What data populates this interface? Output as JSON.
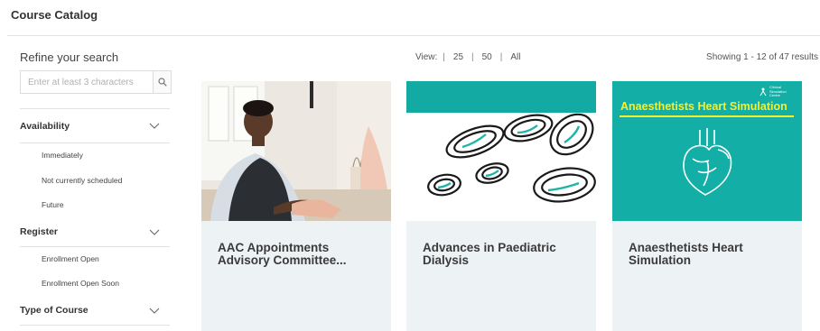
{
  "page": {
    "title": "Course Catalog"
  },
  "sidebar": {
    "heading": "Refine your search",
    "search_placeholder": "Enter at least 3 characters",
    "search_value": "",
    "facets": [
      {
        "title": "Availability",
        "options": [
          "Immediately",
          "Not currently scheduled",
          "Future"
        ]
      },
      {
        "title": "Register",
        "options": [
          "Enrollment Open",
          "Enrollment Open Soon"
        ]
      },
      {
        "title": "Type of Course",
        "options": []
      }
    ]
  },
  "toolbar": {
    "view_label": "View:",
    "view_options": [
      "25",
      "50",
      "All"
    ],
    "separator": "|",
    "results_text": "Showing 1 - 12 of 47 results"
  },
  "cards": [
    {
      "title_line1": "AAC Appointments",
      "title_line2": "Advisory Committee...",
      "image": "photo-handshake"
    },
    {
      "title_line1": "Advances in Paediatric",
      "title_line2": "Dialysis",
      "image": "dialysis-illustration"
    },
    {
      "title_line1": "Anaesthetists Heart",
      "title_line2": "Simulation",
      "image": "heart-simulation-banner",
      "image_heading": "Anaesthetists Heart Simulation",
      "image_brand": [
        "Clinical",
        "Simulation",
        "Centre"
      ]
    }
  ],
  "colors": {
    "teal": "#13aea6",
    "yellow": "#f6ef2c",
    "card_bg": "#edf2f4"
  }
}
